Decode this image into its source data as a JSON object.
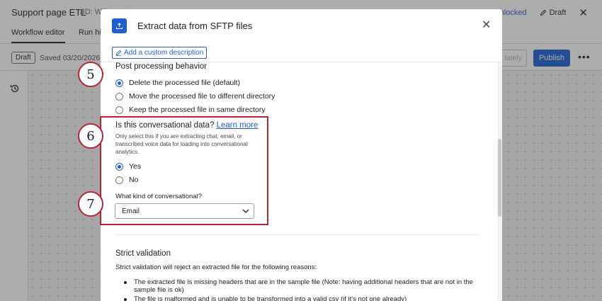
{
  "app": {
    "title": "Support page ETL",
    "id_text": "(ID: WF",
    "status_unlocked": "Unlocked",
    "status_draft": "Draft",
    "tabs": [
      {
        "label": "Workflow editor"
      },
      {
        "label": "Run his"
      }
    ],
    "toolbar": {
      "draft_badge": "Draft",
      "saved_text": "Saved 03/20/2026 at",
      "validate_label": "lately",
      "publish_label": "Publish"
    }
  },
  "modal": {
    "title": "Extract data from SFTP files",
    "description_button": "Add a custom description",
    "post_processing": {
      "title": "Post processing behavior",
      "options": [
        {
          "label": "Delete the processed file (default)",
          "checked": true
        },
        {
          "label": "Move the processed file to different directory",
          "checked": false
        },
        {
          "label": "Keep the processed file in same directory",
          "checked": false
        }
      ]
    },
    "conversational": {
      "title": "Is this conversational data?",
      "learn_more": "Learn more",
      "help": "Only select this if you are extracting chat, email, or transcribed voice data for loading into conversational analytics.",
      "options": [
        {
          "label": "Yes",
          "checked": true
        },
        {
          "label": "No",
          "checked": false
        }
      ],
      "kind_label": "What kind of conversational?",
      "kind_value": "Email"
    },
    "strict_validation": {
      "title": "Strict validation",
      "description": "Strict validation will reject an extracted file for the following reasons:",
      "reasons": [
        "The extracted file is missing headers that are in the sample file (Note: having additional headers that are not in the sample file is ok)",
        "The file is malformed and is unable to be transformed into a valid csv (if it's not one already)"
      ]
    }
  },
  "annotations": {
    "steps": [
      "5",
      "6",
      "7"
    ],
    "color": "#b5262e"
  },
  "colors": {
    "accent": "#1d5fd1",
    "annotation": "#b5262e"
  }
}
